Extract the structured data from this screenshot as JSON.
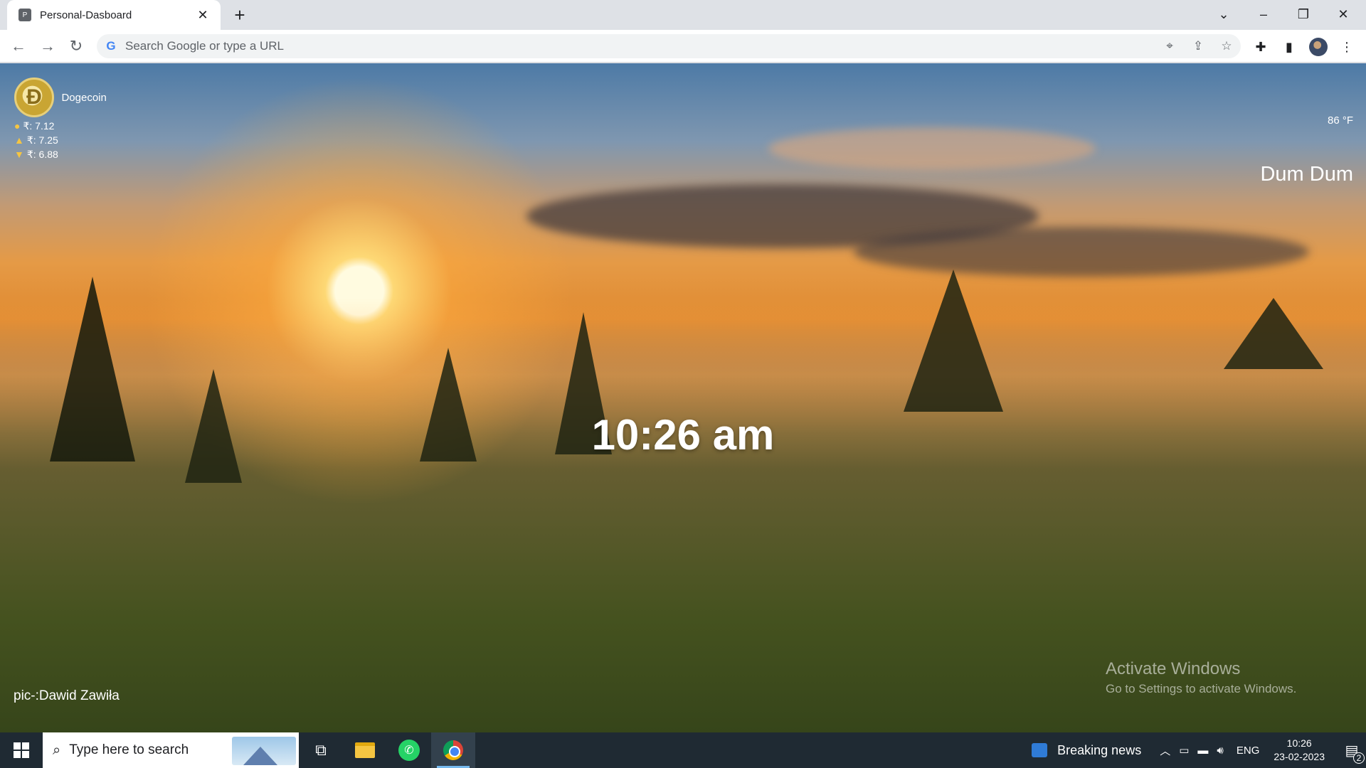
{
  "browser": {
    "tab_title": "Personal-Dasboard",
    "tab_favicon": "P",
    "omnibox_placeholder": "Search Google or type a URL",
    "icons": [
      "back-arrow-icon",
      "forward-arrow-icon",
      "reload-icon",
      "google-g-icon",
      "location-icon",
      "share-icon",
      "star-icon",
      "extensions-puzzle-icon",
      "side-panel-icon",
      "profile-avatar-icon",
      "kebab-menu-icon"
    ]
  },
  "dashboard": {
    "crypto": {
      "name": "Dogecoin",
      "rows": [
        {
          "icon": "coin-bag-icon",
          "text": "₹: 7.12"
        },
        {
          "icon": "thumbs-up-icon",
          "text": "₹: 7.25"
        },
        {
          "icon": "thumbs-down-icon",
          "text": "₹: 6.88"
        }
      ]
    },
    "weather_temp": "86 °F",
    "city": "Dum Dum",
    "time": "10:26 am",
    "credit": "pic-:Dawid Zawiła",
    "watermark": {
      "line1": "Activate Windows",
      "line2": "Go to Settings to activate Windows."
    }
  },
  "taskbar": {
    "search_placeholder": "Type here to search",
    "news_label": "Breaking news",
    "lang": "ENG",
    "clock_time": "10:26",
    "clock_date": "23-02-2023",
    "notifications": "2"
  }
}
